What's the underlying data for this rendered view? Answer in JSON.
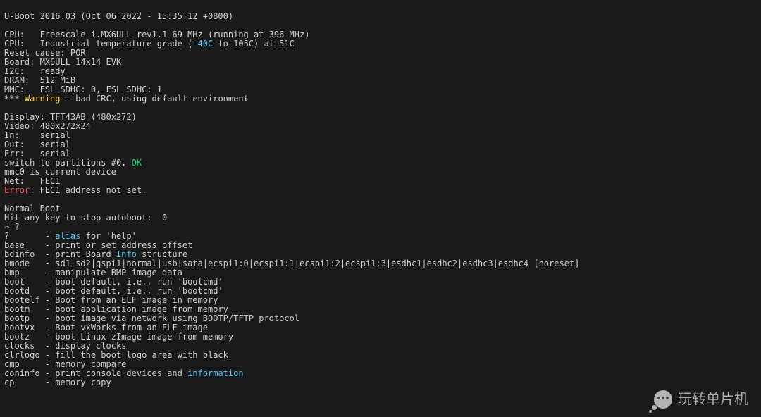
{
  "boot": {
    "header": "U-Boot 2016.03 (Oct 06 2022 - 15:35:12 +0800)",
    "blank1": "",
    "cpu1_pre": "CPU:   Freescale i.MX6ULL rev1.1 69 MHz (running at 396 MHz)",
    "cpu2_pre": "CPU:   Industrial temperature grade (",
    "cpu2_hl": "-40C",
    "cpu2_post": " to 105C) at 51C",
    "reset": "Reset cause: POR",
    "board": "Board: MX6ULL 14x14 EVK",
    "i2c": "I2C:   ready",
    "dram": "DRAM:  512 MiB",
    "mmc": "MMC:   FSL_SDHC: 0, FSL_SDHC: 1",
    "warn_pre": "*** ",
    "warn_hl": "Warning",
    "warn_post": " - bad CRC, using default environment",
    "blank2": "",
    "display": "Display: TFT43AB (480x272)",
    "video": "Video: 480x272x24",
    "in": "In:    serial",
    "out": "Out:   serial",
    "err": "Err:   serial",
    "switch_pre": "switch to partitions #0, ",
    "switch_hl": "OK",
    "mmc0": "mmc0 is current device",
    "net": "Net:   FEC1",
    "error_hl": "Error",
    "error_post": ": FEC1 address not set.",
    "blank3": "",
    "normal": "Normal Boot",
    "autoboot": "Hit any key to stop autoboot:  0",
    "prompt": "⇒ ?",
    "help_q_pre": "?       - ",
    "help_q_hl": "alias",
    "help_q_post": " for 'help'",
    "help_base": "base    - print or set address offset",
    "help_bdinfo_pre": "bdinfo  - print Board ",
    "help_bdinfo_hl": "Info",
    "help_bdinfo_post": " structure",
    "help_bmode": "bmode   - sd1|sd2|qspi1|normal|usb|sata|ecspi1:0|ecspi1:1|ecspi1:2|ecspi1:3|esdhc1|esdhc2|esdhc3|esdhc4 [noreset]",
    "help_bmp": "bmp     - manipulate BMP image data",
    "help_boot": "boot    - boot default, i.e., run 'bootcmd'",
    "help_bootd": "bootd   - boot default, i.e., run 'bootcmd'",
    "help_bootelf": "bootelf - Boot from an ELF image in memory",
    "help_bootm": "bootm   - boot application image from memory",
    "help_bootp": "bootp   - boot image via network using BOOTP/TFTP protocol",
    "help_bootvx": "bootvx  - Boot vxWorks from an ELF image",
    "help_bootz": "bootz   - boot Linux zImage image from memory",
    "help_clocks": "clocks  - display clocks",
    "help_clrlogo": "clrlogo - fill the boot logo area with black",
    "help_cmp": "cmp     - memory compare",
    "help_coninfo_pre": "coninfo - print console devices and ",
    "help_coninfo_hl": "information",
    "help_cp": "cp      - memory copy"
  },
  "watermark": "玩转单片机"
}
